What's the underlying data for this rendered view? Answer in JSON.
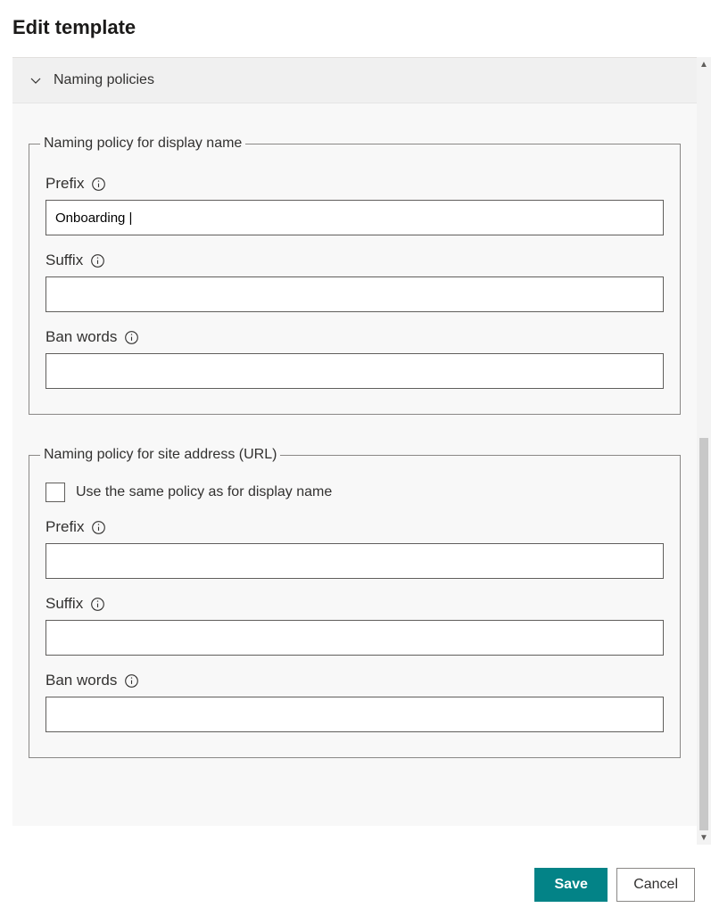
{
  "panel": {
    "title": "Edit template"
  },
  "accordion": {
    "header": "Naming policies"
  },
  "display_policy": {
    "legend": "Naming policy for display name",
    "prefix": {
      "label": "Prefix",
      "value": "Onboarding |"
    },
    "suffix": {
      "label": "Suffix",
      "value": ""
    },
    "ban": {
      "label": "Ban words",
      "value": ""
    }
  },
  "url_policy": {
    "legend": "Naming policy for site address (URL)",
    "same_as_display": {
      "label": "Use the same policy as for display name",
      "checked": false
    },
    "prefix": {
      "label": "Prefix",
      "value": ""
    },
    "suffix": {
      "label": "Suffix",
      "value": ""
    },
    "ban": {
      "label": "Ban words",
      "value": ""
    }
  },
  "footer": {
    "save": "Save",
    "cancel": "Cancel"
  }
}
